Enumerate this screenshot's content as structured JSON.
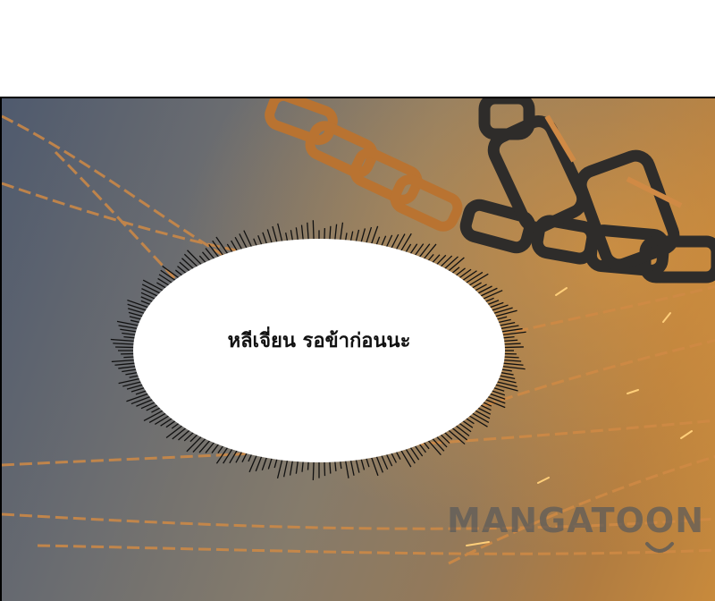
{
  "speech_bubble": {
    "text": "หลีเจี่ยน รอข้าก่อนนะ"
  },
  "watermark": {
    "text": "MANGATOON",
    "icon": "smile-icon"
  },
  "colors": {
    "chain_gold": "#d08a45",
    "chain_dark": "#2e2c2a",
    "bubble_fill": "#ffffff",
    "bubble_burst": "#111111"
  }
}
